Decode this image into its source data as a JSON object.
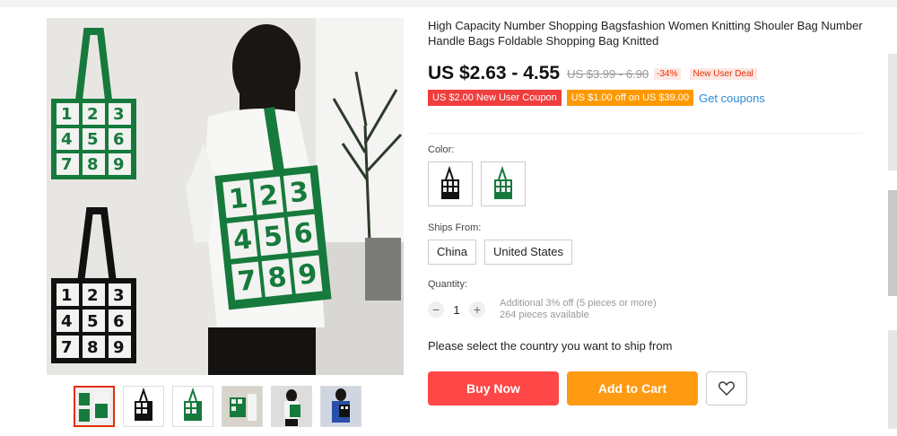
{
  "product": {
    "title": "High Capacity Number Shopping Bagsfashion Women Knitting Shouler Bag Number Handle Bags Foldable Shopping Bag Knitted",
    "price": "US $2.63 - 4.55",
    "original_price": "US $3.99 - 6.90",
    "discount": "-34%",
    "new_user_deal": "New User Deal"
  },
  "coupons": {
    "coupon1": "US $2.00 New User Coupon",
    "coupon2": "US $1.00 off on US $39.00",
    "get_coupons": "Get coupons"
  },
  "colors": {
    "label": "Color:",
    "options": [
      "black bag",
      "green bag"
    ]
  },
  "ships_from": {
    "label": "Ships From:",
    "options": [
      "China",
      "United States"
    ]
  },
  "quantity": {
    "label": "Quantity:",
    "value": "1",
    "minus": "−",
    "plus": "+",
    "note1": "Additional 3% off (5 pieces or more)",
    "note2": "264 pieces available"
  },
  "select_country": "Please select the country you want to ship from",
  "buttons": {
    "buy_now": "Buy Now",
    "add_to_cart": "Add to Cart"
  },
  "bag_numbers": [
    "1",
    "2",
    "3",
    "4",
    "5",
    "6",
    "7",
    "8",
    "9"
  ],
  "colors_hex": {
    "green": "#167a3c",
    "black": "#111111",
    "accent": "#ff4747",
    "orange": "#ff9a13"
  }
}
